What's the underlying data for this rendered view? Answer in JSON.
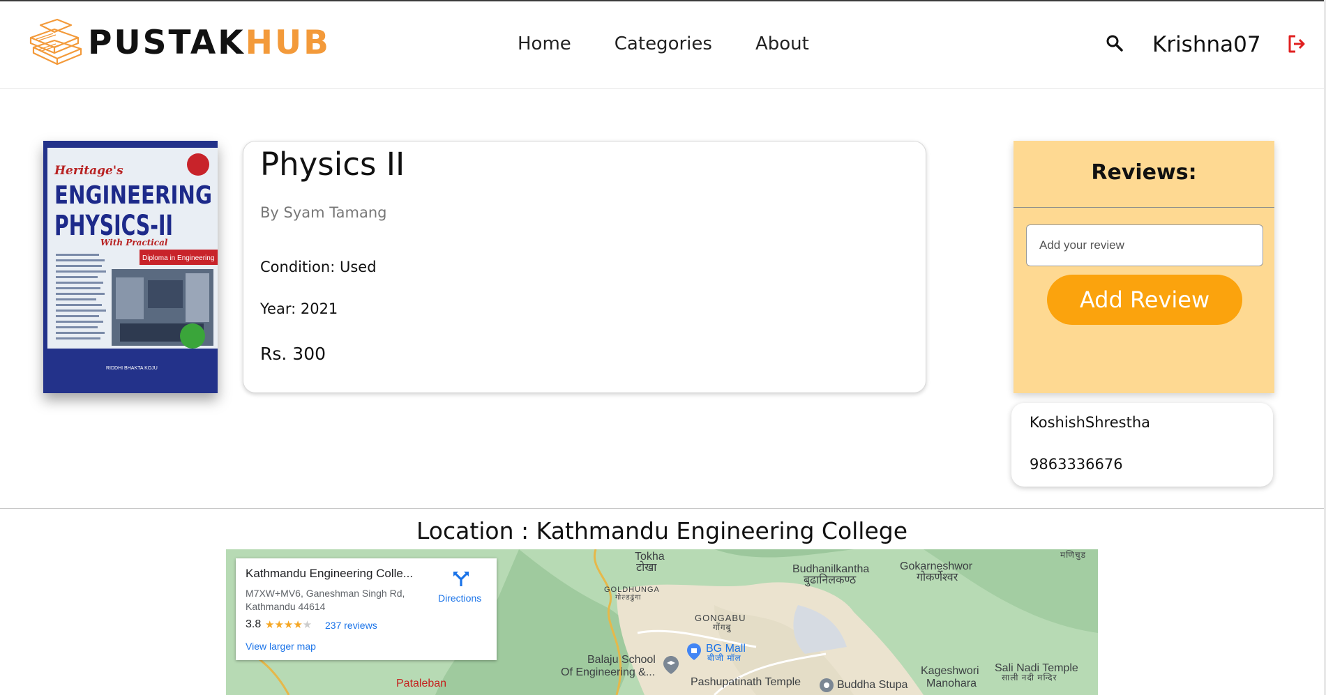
{
  "colors": {
    "accent": "#fba30d",
    "reviews_bg": "#fed992",
    "logo_orange": "#f39a3a",
    "logout_red": "#e02020",
    "link_blue": "#1a73e8"
  },
  "nav": {
    "logo_part1": "PUSTAK",
    "logo_part2": "HUB",
    "links": [
      "Home",
      "Categories",
      "About"
    ],
    "search_icon": "search-icon",
    "username": "Krishna07",
    "logout_icon": "logout-icon"
  },
  "book": {
    "cover": {
      "publisher": "Heritage's",
      "title_line1": "ENGINEERING",
      "title_line2": "PHYSICS-II",
      "subtitle": "With Practical",
      "banner": "Diploma in Engineering",
      "author": "RIDDHI BHAKTA KOJU"
    },
    "title": "Physics II",
    "author": "By Syam Tamang",
    "condition": "Condition: Used",
    "year": "Year: 2021",
    "price": "Rs. 300"
  },
  "reviews": {
    "title": "Reviews:",
    "placeholder": "Add your review",
    "button": "Add Review"
  },
  "seller": {
    "name": "KoshishShrestha",
    "phone": "9863336676"
  },
  "location": {
    "title": "Location : Kathmandu Engineering College",
    "map": {
      "place_name": "Kathmandu Engineering Colle...",
      "address_line1": "M7XW+MV6, Ganeshman Singh Rd,",
      "address_line2": "Kathmandu 44614",
      "rating": "3.8",
      "stars": 3.8,
      "reviews": "237 reviews",
      "directions": "Directions",
      "larger_map": "View larger map",
      "labels": {
        "tokha": "Tokha",
        "tokha_np": "टोखा",
        "budhanilkantha": "Budhanilkantha",
        "budhanilkantha_np": "बुढानिलकण्ठ",
        "gokarneshwor": "Gokarneshwor",
        "gokarneshwor_np": "गोकर्णेश्वर",
        "goldhunga": "GOLDHUNGA",
        "goldhunga_np": "गोल्डढुंगा",
        "gongabu": "GONGABU",
        "gongabu_np": "गोंगबु",
        "bg_mall": "BG Mall",
        "bg_mall_np": "बीजी मॉल",
        "balaju1": "Balaju School",
        "balaju2": "Of Engineering &...",
        "pashupatinath": "Pashupatinath Temple",
        "buddha": "Buddha Stupa",
        "kageshwori1": "Kageshwori",
        "kageshwori2": "Manohara",
        "sali": "Sali Nadi Temple",
        "sali_np": "साली नदी मन्दिर",
        "pataleban": "Pataleban",
        "manichud": "मणिचुड"
      }
    }
  }
}
